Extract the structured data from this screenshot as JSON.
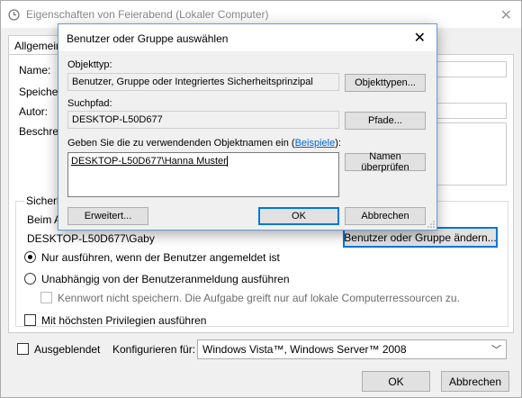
{
  "window": {
    "title": "Eigenschaften von Feierabend (Lokaler Computer)",
    "tab_general": "Allgemein",
    "label_name": "Name:",
    "label_location": "Speicher",
    "label_author": "Autor:",
    "label_description": "Beschrei",
    "security_group": "Sicherh",
    "security_run_as": "Beim A",
    "current_user": "DESKTOP-L50D677\\Gaby",
    "change_user_button": "Benutzer oder Gruppe ändern...",
    "radio_logged_on": "Nur ausführen, wenn der Benutzer angemeldet ist",
    "radio_independent": "Unabhängig von der Benutzeranmeldung ausführen",
    "check_no_password": "Kennwort nicht speichern. Die Aufgabe greift nur auf lokale Computerressourcen zu.",
    "check_highest_privileges": "Mit höchsten Privilegien ausführen",
    "check_hidden": "Ausgeblendet",
    "configure_for_label": "Konfigurieren für:",
    "configure_for_value": "Windows Vista™, Windows Server™ 2008",
    "ok_button": "OK",
    "cancel_button": "Abbrechen"
  },
  "dialog": {
    "title": "Benutzer oder Gruppe auswählen",
    "object_type_label": "Objekttyp:",
    "object_type_value": "Benutzer, Gruppe oder Integriertes Sicherheitsprinzipal",
    "object_types_button": "Objekttypen...",
    "search_path_label": "Suchpfad:",
    "search_path_value": "DESKTOP-L50D677",
    "paths_button": "Pfade...",
    "enter_names_label": "Geben Sie die zu verwendenden Objektnamen ein (",
    "enter_names_link": "Beispiele",
    "enter_names_suffix": "):",
    "names_value": "DESKTOP-L50D677\\Hanna Muster",
    "check_names_button": "Namen überprüfen",
    "advanced_button": "Erweitert...",
    "ok_button": "OK",
    "cancel_button": "Abbrechen"
  }
}
